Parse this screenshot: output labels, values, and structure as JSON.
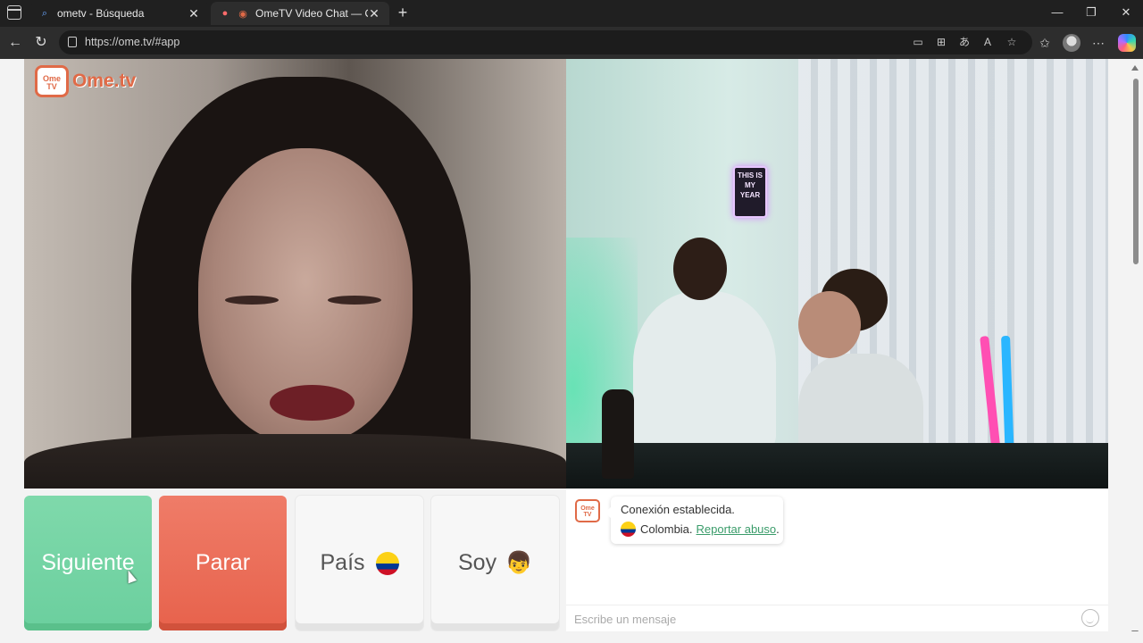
{
  "browser": {
    "tabs": [
      {
        "title": "ometv - Búsqueda",
        "favicon": "search-icon"
      },
      {
        "title": "OmeTV Video Chat — Omeg",
        "favicon": "ometv-favicon"
      }
    ],
    "url": "https://ome.tv/#app"
  },
  "app": {
    "logo_badge": "Ome TV",
    "logo_text": "Ome.tv"
  },
  "video_right": {
    "neon_sign": "THIS IS MY YEAR"
  },
  "buttons": {
    "next": "Siguiente",
    "stop": "Parar",
    "country": "País",
    "gender": "Soy"
  },
  "chat": {
    "logo_badge": "Ome TV",
    "message_line1": "Conexión establecida.",
    "country": "Colombia.",
    "report_link": "Reportar abuso",
    "report_suffix": ".",
    "input_placeholder": "Escribe un mensaje"
  },
  "colors": {
    "next_button": "#6bcf9e",
    "stop_button": "#e7624c",
    "brand": "#e06a47",
    "link": "#3a9c6a"
  }
}
